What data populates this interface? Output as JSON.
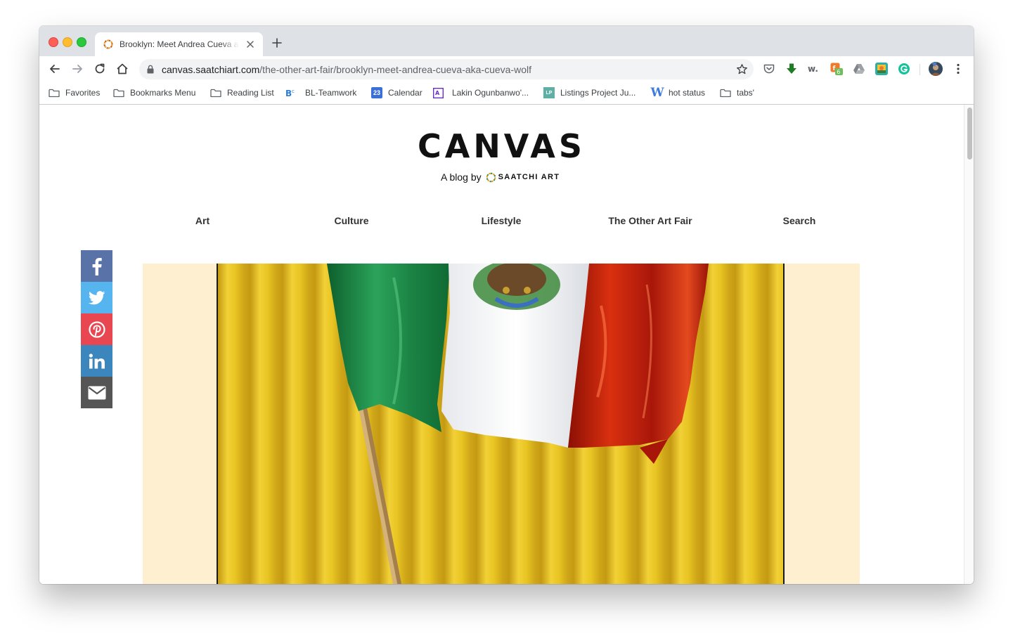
{
  "browser": {
    "tab_title": "Brooklyn: Meet Andrea Cueva aka Cueva Wolf",
    "url_host": "canvas.saatchiart.com",
    "url_path": "/the-other-art-fair/brooklyn-meet-andrea-cueva-aka-cueva-wolf",
    "extension_badge": "6",
    "bookmarks": [
      {
        "label": "Favorites",
        "icon": "folder-icon"
      },
      {
        "label": "Bookmarks Menu",
        "icon": "folder-icon"
      },
      {
        "label": "Reading List",
        "icon": "folder-icon"
      },
      {
        "label": "BL-Teamwork",
        "icon": "teamwork-icon"
      },
      {
        "label": "Calendar",
        "icon": "calendar-icon",
        "icon_text": "23"
      },
      {
        "label": "Lakin Ogunbanwo'...",
        "icon": "artsy-icon"
      },
      {
        "label": "Listings Project Ju...",
        "icon": "listings-project-icon",
        "icon_text": "LP"
      },
      {
        "label": "hot status",
        "icon": "w-icon",
        "icon_text": "W"
      },
      {
        "label": "tabs'",
        "icon": "folder-icon"
      }
    ]
  },
  "site": {
    "logo": "CANVAS",
    "byline_prefix": "A blog by",
    "byline_brand": "SAATCHI ART",
    "nav": [
      "Art",
      "Culture",
      "Lifestyle",
      "The Other Art Fair",
      "Search"
    ]
  },
  "share": [
    "facebook-icon",
    "twitter-icon",
    "pinterest-icon",
    "linkedin-icon",
    "email-icon"
  ],
  "colors": {
    "facebook": "#5973a8",
    "twitter": "#56b4ef",
    "pinterest": "#e84650",
    "linkedin": "#3b87bd",
    "email": "#555555",
    "hero_background": "#fdefd0",
    "curtain_yellow": "#e8c51e",
    "flag_green": "#1a8a45",
    "flag_white": "#ffffff",
    "flag_red": "#b81d0c"
  }
}
